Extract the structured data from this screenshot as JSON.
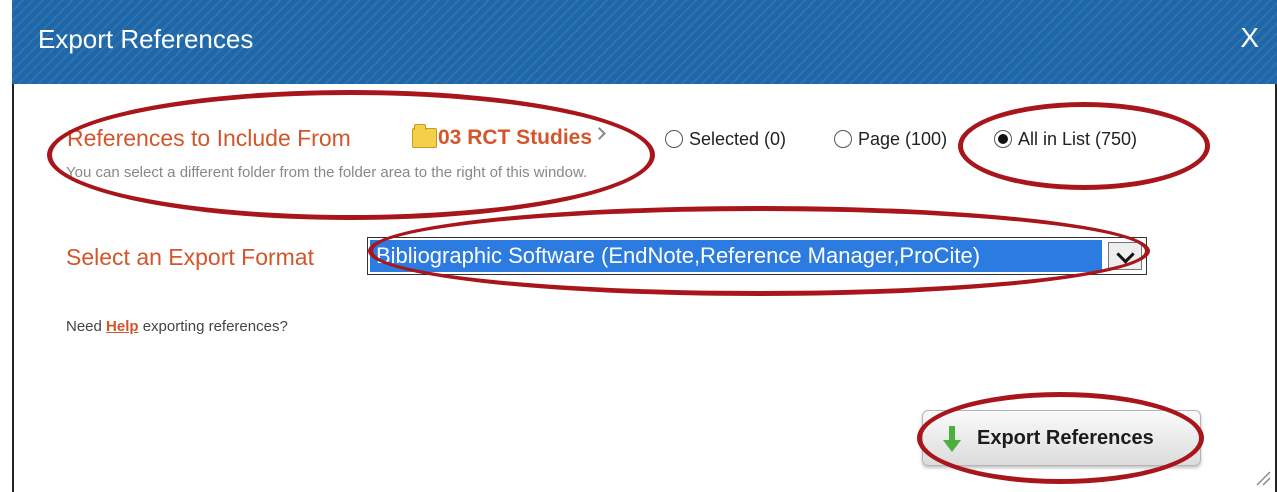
{
  "dialog": {
    "title": "Export References",
    "close_label": "X"
  },
  "include": {
    "label": "References to Include From",
    "folder_icon": "folder-icon",
    "folder_name": "03 RCT Studies",
    "options": [
      {
        "label": "Selected (0)",
        "checked": false
      },
      {
        "label": "Page (100)",
        "checked": false
      },
      {
        "label": "All in List (750)",
        "checked": true
      }
    ],
    "hint": "You can select a different folder from the folder area to the right of this window."
  },
  "format": {
    "label": "Select an Export Format",
    "selected_value": "Bibliographic Software (EndNote,Reference Manager,ProCite)"
  },
  "help": {
    "prefix": "Need ",
    "link": "Help",
    "suffix": " exporting references?"
  },
  "action": {
    "export_label": "Export References",
    "icon": "down-arrow-icon"
  },
  "colors": {
    "titlebar": "#1e67a8",
    "accent_orange": "#d2562a",
    "selection_blue": "#2b7be0",
    "annotation_red": "#a8151a"
  }
}
